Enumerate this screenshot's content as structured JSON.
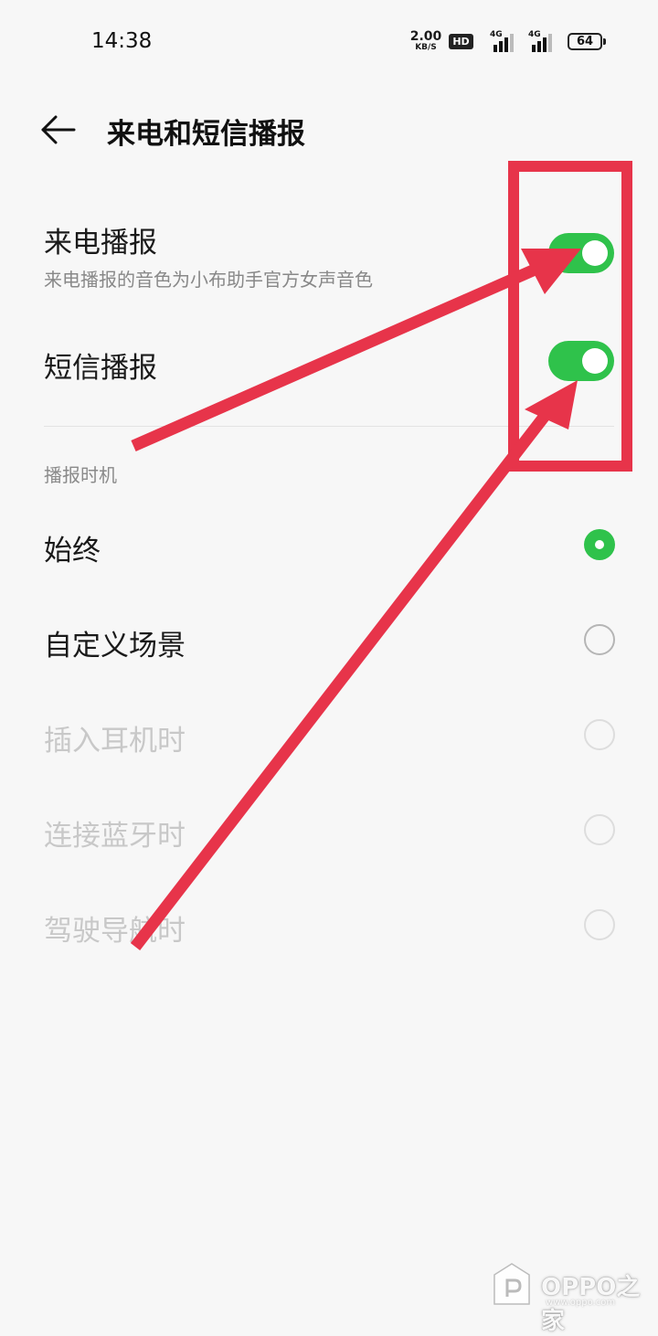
{
  "status_bar": {
    "time": "14:38",
    "net_speed_value": "2.00",
    "net_speed_unit": "KB/S",
    "hd_badge": "HD",
    "sim1_type": "4G",
    "sim2_type": "4G",
    "battery": "64"
  },
  "header": {
    "title": "来电和短信播报",
    "back_icon": "arrow-left-icon"
  },
  "settings": {
    "call_announce": {
      "label": "来电播报",
      "description": "来电播报的音色为小布助手官方女声音色",
      "enabled": true
    },
    "sms_announce": {
      "label": "短信播报",
      "enabled": true
    }
  },
  "timing": {
    "section_label": "播报时机",
    "options": [
      {
        "label": "始终",
        "selected": true,
        "enabled": true
      },
      {
        "label": "自定义场景",
        "selected": false,
        "enabled": true
      },
      {
        "label": "插入耳机时",
        "selected": false,
        "enabled": false
      },
      {
        "label": "连接蓝牙时",
        "selected": false,
        "enabled": false
      },
      {
        "label": "驾驶导航时",
        "selected": false,
        "enabled": false
      }
    ]
  },
  "colors": {
    "accent": "#2fc24b",
    "annotation": "#e7344a",
    "background": "#f7f7f7"
  },
  "watermark": {
    "text": "OPPO之家",
    "url": "www.oppo.com"
  }
}
